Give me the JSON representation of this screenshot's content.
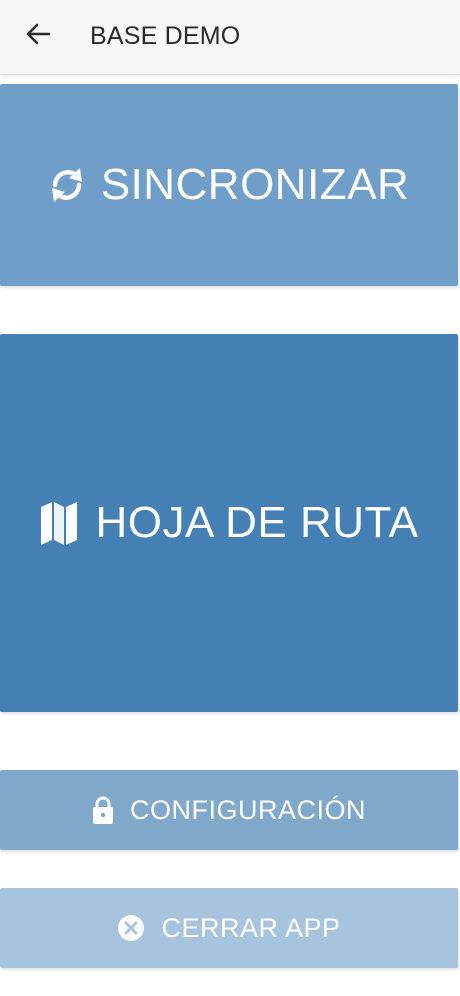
{
  "appbar": {
    "title": "BASE DEMO",
    "back_icon": "arrow-left-icon"
  },
  "menu": {
    "sync": {
      "label": "SINCRONIZAR",
      "icon": "sync-icon",
      "color": "#6f9fc8"
    },
    "route": {
      "label": "HOJA DE RUTA",
      "icon": "map-icon",
      "color": "#4480b4"
    },
    "config": {
      "label": "CONFIGURACIÓN",
      "icon": "lock-icon",
      "color": "#80a8cb"
    },
    "close": {
      "label": "CERRAR APP",
      "icon": "close-circle-icon",
      "color": "#a7c4de"
    }
  }
}
